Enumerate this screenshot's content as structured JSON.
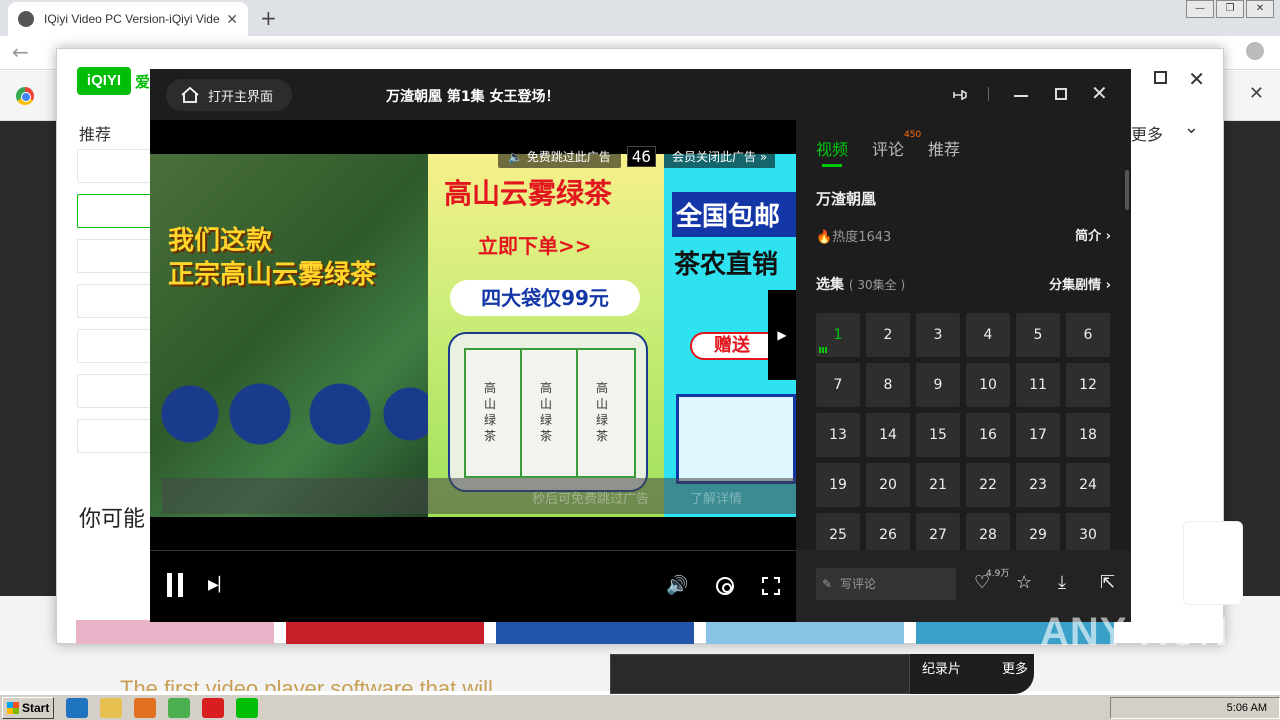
{
  "browser": {
    "tab_title": "IQiyi Video PC Version-iQiyi Video Of",
    "tab_close": "✕",
    "new_tab": "+"
  },
  "website": {
    "nav_recommend": "推荐",
    "nav_more": "更多",
    "you_may_like": "你可能",
    "tagline": "The first video player software that will",
    "logo_text": "iQIYI",
    "logo_suffix": "爱奇"
  },
  "player": {
    "home_button": "打开主界面",
    "episode_title": "万渣朝凰 第1集 女王登场！",
    "ad": {
      "skip_text": "免费跳过此广告",
      "countdown": "46",
      "vip_close": "会员关闭此广告 »",
      "bottom_hint": "秒后可免费跳过广告",
      "learn_more": "了解详情",
      "slogan_line1": "我们这款",
      "slogan_line2": "正宗高山云雾绿茶",
      "headline": "高山云雾绿茶",
      "order_now": "立即下单>>",
      "price": "四大袋仅99元",
      "free_shipping": "全国包邮",
      "direct_sale": "茶农直销",
      "gift": "赠送",
      "bag_label": "高山绿茶"
    },
    "side": {
      "tab_video": "视频",
      "tab_comments": "评论",
      "comments_badge": "450",
      "tab_recommend": "推荐",
      "show_title": "万渣朝凰",
      "heat": "热度1643",
      "intro": "简介",
      "select_label": "选集",
      "select_count": "( 30集全 )",
      "plot_by_ep": "分集剧情",
      "episodes": [
        "1",
        "2",
        "3",
        "4",
        "5",
        "6",
        "7",
        "8",
        "9",
        "10",
        "11",
        "12",
        "13",
        "14",
        "15",
        "16",
        "17",
        "18",
        "19",
        "20",
        "21",
        "22",
        "23",
        "24",
        "25",
        "26",
        "27",
        "28",
        "29",
        "30"
      ],
      "current_episode": "1"
    },
    "bottom": {
      "comment_placeholder": "写评论",
      "like_count": "4.9万"
    }
  },
  "popup": {
    "documentary": "纪录片",
    "more": "更多"
  },
  "taskbar": {
    "start": "Start",
    "time": "5:06 AM"
  },
  "watermark": "ANY RUN"
}
